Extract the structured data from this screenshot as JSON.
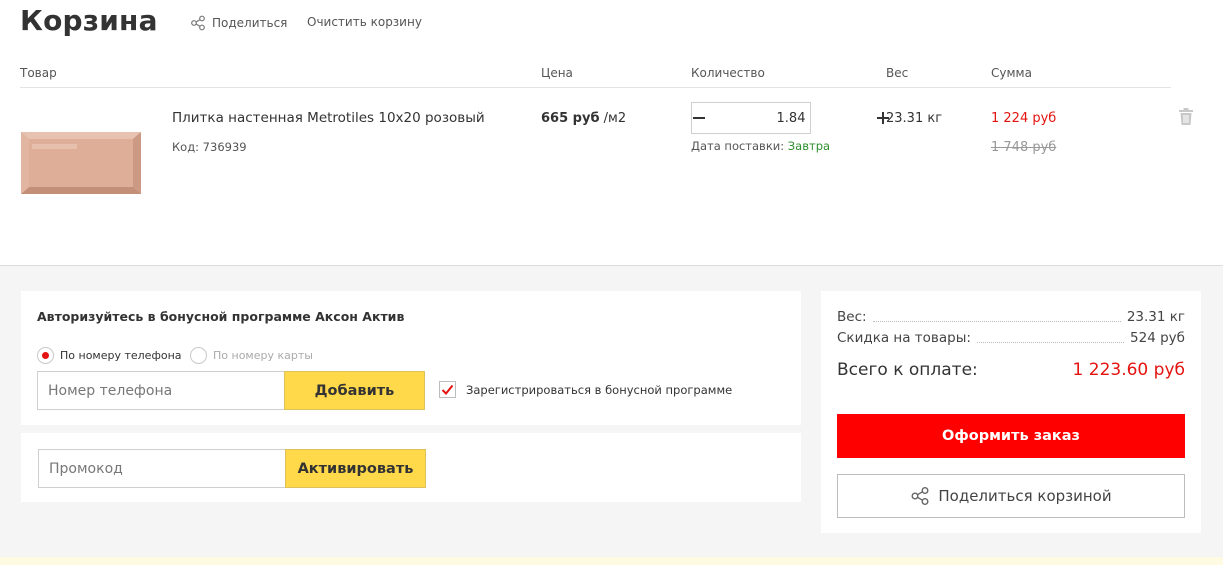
{
  "header": {
    "title": "Корзина",
    "share_label": "Поделиться",
    "clear_label": "Очистить корзину"
  },
  "table": {
    "columns": [
      "Товар",
      "Цена",
      "Количество",
      "Вес",
      "Сумма"
    ]
  },
  "item": {
    "name": "Плитка настенная Metrotiles 10x20 розовый",
    "code": "Код: 736939",
    "price_value": "665 руб",
    "price_unit": " /м2",
    "quantity": "1.84",
    "delivery_label": "Дата поставки: ",
    "delivery_value": "Завтра",
    "weight": "23.31 кг",
    "sum": "1 224 руб",
    "old_sum": "1 748 руб"
  },
  "bonus": {
    "title": "Авторизуйтесь в бонусной программе Аксон Актив",
    "radio_phone": "По номеру телефона",
    "radio_card": "По номеру карты",
    "phone_placeholder": "Номер телефона",
    "add_button": "Добавить",
    "register_checkbox": "Зарегистрироваться в бонусной программе"
  },
  "promo": {
    "placeholder": "Промокод",
    "activate_button": "Активировать"
  },
  "summary": {
    "weight_label": "Вес:",
    "weight_value": "23.31 кг",
    "discount_label": "Скидка на товары:",
    "discount_value": "524 руб",
    "total_label": "Всего к оплате:",
    "total_value": "1 223.60 руб",
    "order_button": "Оформить заказ",
    "share_button": "Поделиться корзиной"
  },
  "colors": {
    "accent_red": "#ff0000",
    "price_red": "#e4130f",
    "yellow_button": "#ffd94a",
    "delivery_green": "#2f8f2f"
  }
}
